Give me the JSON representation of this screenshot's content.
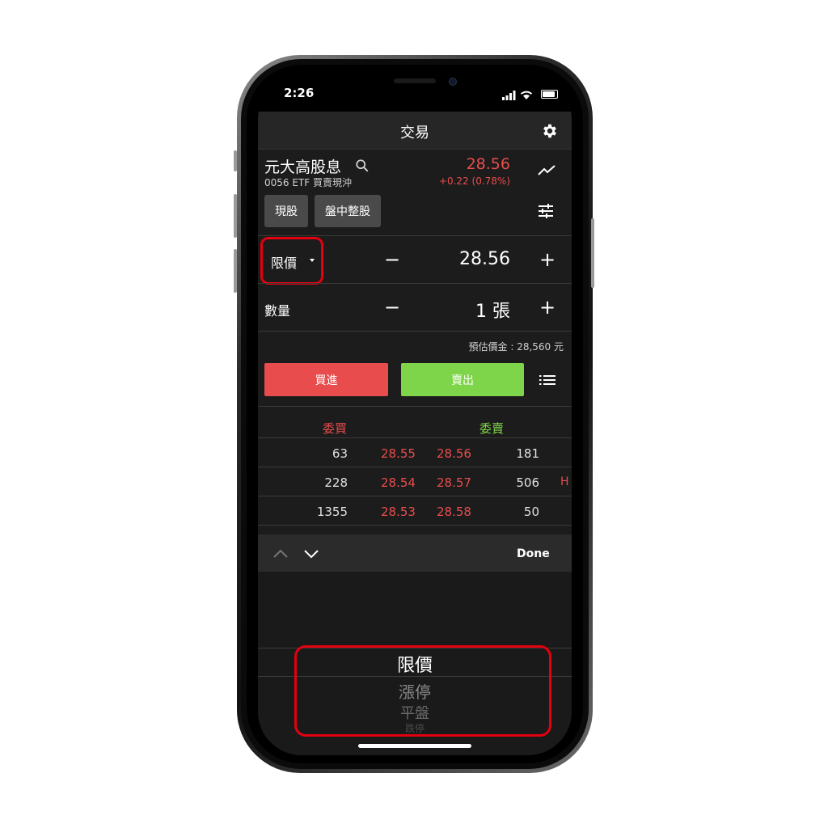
{
  "status_bar": {
    "time": "2:26"
  },
  "header": {
    "title": "交易",
    "settings_icon": "gear-icon"
  },
  "stock": {
    "name": "元大高股息",
    "subtitle": "0056 ETF 買賣現沖",
    "price": "28.56",
    "change": "+0.22 (0.78%)"
  },
  "tabs": [
    {
      "label": "現股"
    },
    {
      "label": "盤中整股"
    }
  ],
  "order": {
    "price_type": "限價",
    "price_value": "28.56",
    "qty_label": "數量",
    "qty_value": "1 張",
    "minus": "−",
    "plus": "+",
    "estimate": "預估價金 : 28,560 元"
  },
  "actions": {
    "buy": "買進",
    "sell": "賣出"
  },
  "orderbook": {
    "bid_label": "委買",
    "ask_label": "委賣",
    "rows": [
      {
        "bid_vol": "63",
        "bid_price": "28.55",
        "ask_price": "28.56",
        "ask_vol": "181",
        "extra": ""
      },
      {
        "bid_vol": "228",
        "bid_price": "28.54",
        "ask_price": "28.57",
        "ask_vol": "506",
        "extra": "H"
      },
      {
        "bid_vol": "1355",
        "bid_price": "28.53",
        "ask_price": "28.58",
        "ask_vol": "50",
        "extra": ""
      }
    ]
  },
  "keyboard_toolbar": {
    "done": "Done"
  },
  "picker": {
    "options": [
      "限價",
      "漲停",
      "平盤",
      "跌停"
    ]
  },
  "colors": {
    "up": "#e84c4c",
    "down": "#7fd54a",
    "highlight": "#e3000f"
  }
}
